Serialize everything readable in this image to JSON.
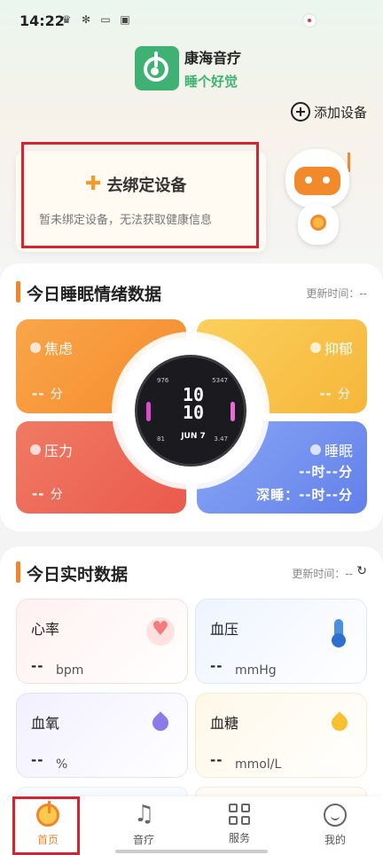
{
  "status_bar": {
    "time": "14:22"
  },
  "header": {
    "brand_name": "康海音疗",
    "slogan": "睡个好觉",
    "add_device_label": "添加设备"
  },
  "bind_card": {
    "title": "去绑定设备",
    "subtitle": "暂未绑定设备，无法获取健康信息"
  },
  "emotion_section": {
    "title": "今日睡眠情绪数据",
    "update_label": "更新时间：--",
    "items": [
      {
        "label": "焦虑",
        "value": "--",
        "unit": "分",
        "color": "#f58a2b"
      },
      {
        "label": "抑郁",
        "value": "--",
        "unit": "分",
        "color": "#f6b63a"
      },
      {
        "label": "压力",
        "value": "--",
        "unit": "分",
        "color": "#ea5a4c"
      },
      {
        "label": "睡眠",
        "value": "--时--分",
        "deep_sleep": "深睡：--时--分",
        "color": "#6280ea"
      }
    ],
    "watch": {
      "hour": "10",
      "minute": "10",
      "date": "JUN 7",
      "top_left": "976",
      "top_right": "5347",
      "bottom_left": "81",
      "bottom_right": "3.47"
    }
  },
  "realtime_section": {
    "title": "今日实时数据",
    "update_label": "更新时间：--",
    "metrics": [
      {
        "label": "心率",
        "value": "--",
        "unit": "bpm",
        "icon": "heart-icon"
      },
      {
        "label": "血压",
        "value": "--",
        "unit": "mmHg",
        "icon": "thermometer-icon"
      },
      {
        "label": "血氧",
        "value": "--",
        "unit": "%",
        "icon": "drop-icon"
      },
      {
        "label": "血糖",
        "value": "--",
        "unit": "mmol/L",
        "icon": "sugar-drop-icon"
      }
    ]
  },
  "tabbar": {
    "tabs": [
      {
        "label": "首页",
        "active": true
      },
      {
        "label": "音疗",
        "active": false
      },
      {
        "label": "服务",
        "active": false
      },
      {
        "label": "我的",
        "active": false
      }
    ]
  },
  "colors": {
    "brand_green": "#3fb172",
    "accent_orange": "#f0852a",
    "highlight_red": "#d6232f"
  }
}
